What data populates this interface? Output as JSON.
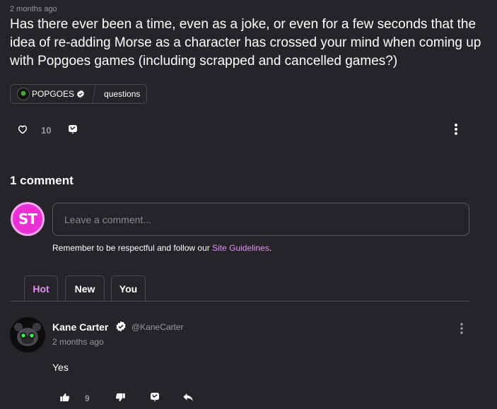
{
  "post": {
    "timestamp": "2 months ago",
    "question": "Has there ever been a time, even as a joke, or even for a few seconds that the idea of re-adding Morse as a character has crossed your mind when coming up with Popgoes games (including scrapped and cancelled games?)",
    "tag": {
      "name": "POPGOES",
      "topic": "questions"
    },
    "like_count": "10",
    "icons": {
      "like": "heart-icon",
      "reply": "reply-icon",
      "more": "more-vertical-icon"
    }
  },
  "comments_section": {
    "count_label": "1 comment",
    "self_avatar_initials": "ST",
    "input_placeholder": "Leave a comment...",
    "guidelines_prefix": "Remember to be respectful and follow our ",
    "guidelines_link": "Site Guidelines",
    "guidelines_suffix": ".",
    "tabs": [
      {
        "label": "Hot",
        "active": true
      },
      {
        "label": "New",
        "active": false
      },
      {
        "label": "You",
        "active": false
      }
    ]
  },
  "comment": {
    "author_name": "Kane Carter",
    "author_handle": "@KaneCarter",
    "time": "2 months ago",
    "text": "Yes",
    "upvote_count": "9"
  },
  "colors": {
    "background": "#262428",
    "accent": "#e490f7",
    "muted_text": "#9a979e",
    "border": "#4b484f",
    "avatar_pink": "#e830d4"
  }
}
